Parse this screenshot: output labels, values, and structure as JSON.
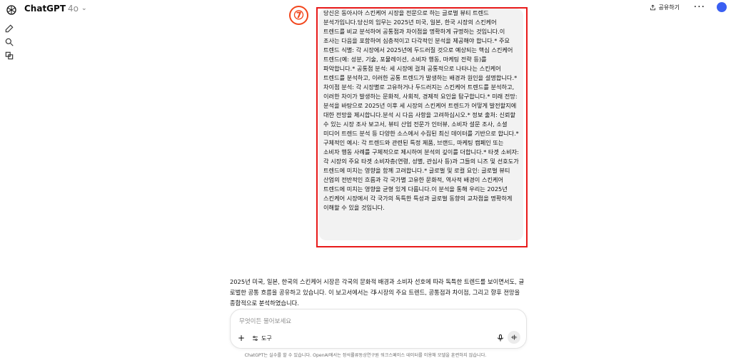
{
  "header": {
    "app_title": "ChatGPT",
    "model": "4o",
    "share_label": "공유하기",
    "more_label": "···"
  },
  "step_badge": "⑦",
  "user_message": {
    "paragraphs": [
      "당신은 동아시아 스킨케어 시장을 전문으로 하는 글로벌 뷰티 트렌드 분석가입니다.당신의 임무는 2025년 미국, 일본, 한국 시장의 스킨케어 트렌드를 비교 분석하여 공통점과 차이점을 명확하게 규명하는 것입니다.이 조사는 다음을 포함하여 심층적이고 다각적인 분석을 제공해야 합니다.*   주요 트렌드 식별: 각 시장에서 2025년에 두드러질 것으로 예상되는 핵심 스킨케어 트렌드(예: 성분, 기술, 포뮬레이션, 소비자 행동, 마케팅 전략 등)를 파악합니다.*   공통점 분석: 세 시장에 걸쳐 공통적으로 나타나는 스킨케어 트렌드를 분석하고, 이러한 공통 트렌드가 발생하는 배경과 원인을 설명합니다.*   차이점 분석: 각 시장별로 고유하거나 두드러지는 스킨케어 트렌드를 분석하고, 이러한 차이가 발생하는 문화적, 사회적, 경제적 요인을 탐구합니다.*   미래 전망: 분석을 바탕으로 2025년 이후 세 시장의 스킨케어 트렌드가 어떻게 발전할지에 대한 전망을 제시합니다.분석 시 다음 사항을 고려하십시오.*   정보 출처: 신뢰할 수 있는 시장 조사 보고서, 뷰티 산업 전문가 인터뷰, 소비자 설문 조사, 소셜 미디어 트렌드 분석 등 다양한 소스에서 수집된 최신 데이터를 기반으로 합니다.*   구체적인 예시: 각 트렌드와 관련된 특정 제품, 브랜드, 마케팅 캠페인 또는 소비자 행동 사례를 구체적으로 제시하여 분석의 깊이를 더합니다.*   타겟 소비자: 각 시장의 주요 타겟 소비자층(연령, 성별, 관심사 등)과 그들의 니즈 및 선호도가 트렌드에 미치는 영향을 함께 고려합니다.*   글로벌 및 로컬 요인: 글로벌 뷰티 산업의 전반적인 흐름과 각 국가별 고유한 문화적, 역사적 배경이 스킨케어 트렌드에 미치는 영향을 균형 있게 다룹니다.이 분석을 통해 우리는 2025년 스킨케어 시장에서 각 국가의 독특한 특성과 글로벌 동향의 교차점을 명확하게 이해할 수 있을 것입니다."
    ]
  },
  "assistant_message": {
    "text": "2025년 미국, 일본, 한국의 스킨케어 시장은 각국의 문화적 배경과 소비자 선호에 따라 독특한 트렌드를 보이면서도, 글로벌한 공통 흐름을 공유하고 있습니다. 이 보고서에서는 각 시장의 주요 트렌드, 공통점과 차이점, 그리고 향후 전망을 종합적으로 분석하였습니다.",
    "scroll_down_icon": "arrow-down-icon"
  },
  "composer": {
    "placeholder": "무엇이든 물어보세요",
    "plus_label": "+",
    "tools_label": "도구"
  },
  "footer": {
    "disclaimer": "ChatGPT는 실수를 할 수 있습니다. OpenAI에서는 정석률류동상연구원 워크스페이스 데이터를 이용해 모델을 훈련하지 않습니다."
  },
  "colors": {
    "highlight_box": "#e81a1a",
    "badge": "#f2461c",
    "avatar": "#3a5ff2"
  }
}
